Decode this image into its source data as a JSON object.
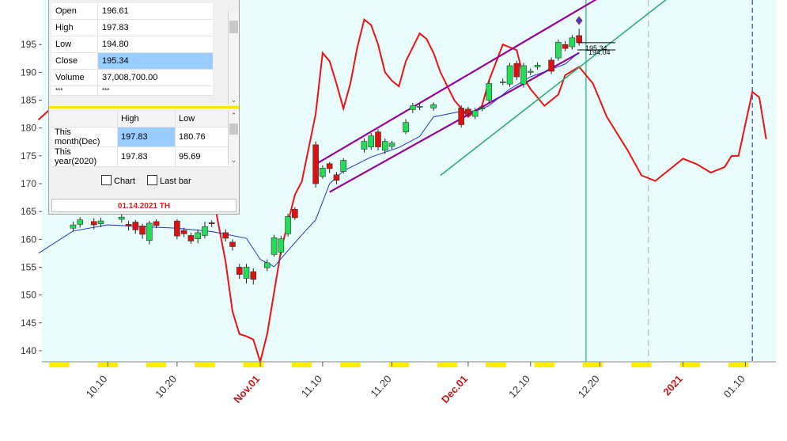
{
  "info_panel": {
    "rows": [
      {
        "label": "Open",
        "value": "196.61"
      },
      {
        "label": "High",
        "value": "197.83"
      },
      {
        "label": "Low",
        "value": "194.80"
      },
      {
        "label": "Close",
        "value": "195.34"
      },
      {
        "label": "Volume",
        "value": "37,008,700.00"
      },
      {
        "label": "***",
        "value": "***"
      }
    ],
    "range_header": {
      "high": "High",
      "low": "Low"
    },
    "range_rows": [
      {
        "label": "This month(Dec)",
        "high": "197.83",
        "low": "180.76"
      },
      {
        "label": "This year(2020)",
        "high": "197.83",
        "low": "95.69"
      }
    ],
    "chart_checkbox": "Chart",
    "lastbar_checkbox": "Last bar",
    "status_date": "01.14.2021 TH"
  },
  "price_tags": {
    "top": "195.34",
    "bottom": "194.04"
  },
  "colors": {
    "background": "#e8fcfc",
    "up": "#22dd55",
    "down": "#dd1111",
    "cycle": "#ee1111",
    "ma": "#2233cc",
    "channel": "#990099",
    "trend": "#33aa77"
  },
  "chart_data": {
    "type": "candlestick",
    "y_ticks": [
      140,
      145,
      150,
      155,
      160,
      165,
      170,
      175,
      180,
      185,
      190,
      195
    ],
    "ylim": [
      138,
      203
    ],
    "x_ticks": [
      {
        "label": "10.10",
        "day": 10,
        "red": false
      },
      {
        "label": "10.20",
        "day": 20,
        "red": false
      },
      {
        "label": "Nov.01",
        "day": 32,
        "red": true
      },
      {
        "label": "11.10",
        "day": 41,
        "red": false
      },
      {
        "label": "11.20",
        "day": 51,
        "red": false
      },
      {
        "label": "Dec.01",
        "day": 62,
        "red": true
      },
      {
        "label": "12.10",
        "day": 71,
        "red": false
      },
      {
        "label": "12.20",
        "day": 81,
        "red": false
      },
      {
        "label": "2021",
        "day": 93,
        "red": true
      },
      {
        "label": "01.10",
        "day": 102,
        "red": false
      }
    ],
    "candles": [
      {
        "day": 5,
        "o": 162.0,
        "c": 162.6,
        "h": 163.2,
        "l": 161.4
      },
      {
        "day": 6,
        "o": 162.7,
        "c": 163.5,
        "h": 164.0,
        "l": 162.1
      },
      {
        "day": 8,
        "o": 163.2,
        "c": 162.6,
        "h": 163.8,
        "l": 161.8
      },
      {
        "day": 9,
        "o": 162.8,
        "c": 163.3,
        "h": 163.9,
        "l": 162.2
      },
      {
        "day": 12,
        "o": 163.6,
        "c": 164.0,
        "h": 164.5,
        "l": 163.0
      },
      {
        "day": 13,
        "o": 162.7,
        "c": 162.4,
        "h": 163.3,
        "l": 161.6
      },
      {
        "day": 14,
        "o": 163.1,
        "c": 161.7,
        "h": 163.5,
        "l": 161.0
      },
      {
        "day": 15,
        "o": 162.4,
        "c": 160.9,
        "h": 162.8,
        "l": 160.1
      },
      {
        "day": 16,
        "o": 159.8,
        "c": 162.9,
        "h": 163.3,
        "l": 159.1
      },
      {
        "day": 17,
        "o": 163.2,
        "c": 162.5,
        "h": 163.6,
        "l": 162.0
      },
      {
        "day": 20,
        "o": 163.3,
        "c": 160.6,
        "h": 163.6,
        "l": 160.0
      },
      {
        "day": 21,
        "o": 161.6,
        "c": 161.0,
        "h": 162.1,
        "l": 160.4
      },
      {
        "day": 22,
        "o": 160.7,
        "c": 159.7,
        "h": 161.2,
        "l": 159.2
      },
      {
        "day": 23,
        "o": 160.1,
        "c": 161.2,
        "h": 161.8,
        "l": 159.3
      },
      {
        "day": 24,
        "o": 160.7,
        "c": 162.3,
        "h": 163.2,
        "l": 160.2
      },
      {
        "day": 25,
        "o": 163.0,
        "c": 162.8,
        "h": 163.4,
        "l": 162.2
      },
      {
        "day": 27,
        "o": 161.2,
        "c": 160.2,
        "h": 161.8,
        "l": 159.6
      },
      {
        "day": 28,
        "o": 159.5,
        "c": 158.7,
        "h": 160.0,
        "l": 158.0
      },
      {
        "day": 29,
        "o": 155.0,
        "c": 153.7,
        "h": 155.6,
        "l": 152.9
      },
      {
        "day": 30,
        "o": 153.0,
        "c": 155.0,
        "h": 155.6,
        "l": 152.1
      },
      {
        "day": 31,
        "o": 154.2,
        "c": 152.8,
        "h": 154.8,
        "l": 151.9
      },
      {
        "day": 33,
        "o": 154.9,
        "c": 155.8,
        "h": 156.4,
        "l": 154.3
      },
      {
        "day": 34,
        "o": 157.3,
        "c": 160.3,
        "h": 160.8,
        "l": 156.9
      },
      {
        "day": 35,
        "o": 157.7,
        "c": 160.1,
        "h": 160.6,
        "l": 157.2
      },
      {
        "day": 36,
        "o": 161.0,
        "c": 164.1,
        "h": 164.6,
        "l": 160.5
      },
      {
        "day": 37,
        "o": 165.4,
        "c": 163.9,
        "h": 165.8,
        "l": 163.5
      },
      {
        "day": 40,
        "o": 177.0,
        "c": 170.0,
        "h": 177.6,
        "l": 169.3
      },
      {
        "day": 41,
        "o": 171.3,
        "c": 172.8,
        "h": 173.3,
        "l": 170.9
      },
      {
        "day": 42,
        "o": 173.6,
        "c": 172.7,
        "h": 173.9,
        "l": 171.9
      },
      {
        "day": 43,
        "o": 171.6,
        "c": 170.6,
        "h": 172.1,
        "l": 169.9
      },
      {
        "day": 44,
        "o": 172.2,
        "c": 174.2,
        "h": 174.6,
        "l": 171.8
      },
      {
        "day": 47,
        "o": 176.2,
        "c": 177.6,
        "h": 178.1,
        "l": 175.6
      },
      {
        "day": 48,
        "o": 176.6,
        "c": 178.6,
        "h": 179.1,
        "l": 176.1
      },
      {
        "day": 49,
        "o": 179.3,
        "c": 176.6,
        "h": 179.8,
        "l": 176.0
      },
      {
        "day": 50,
        "o": 176.0,
        "c": 177.6,
        "h": 178.1,
        "l": 175.4
      },
      {
        "day": 51,
        "o": 176.7,
        "c": 177.3,
        "h": 177.7,
        "l": 176.2
      },
      {
        "day": 53,
        "o": 179.3,
        "c": 181.0,
        "h": 181.6,
        "l": 178.9
      },
      {
        "day": 54,
        "o": 183.3,
        "c": 184.0,
        "h": 184.5,
        "l": 182.7
      },
      {
        "day": 55,
        "o": 183.9,
        "c": 183.9,
        "h": 184.4,
        "l": 183.2
      },
      {
        "day": 57,
        "o": 183.6,
        "c": 184.2,
        "h": 184.6,
        "l": 183.1
      },
      {
        "day": 61,
        "o": 183.6,
        "c": 180.6,
        "h": 184.1,
        "l": 180.1
      },
      {
        "day": 62,
        "o": 183.4,
        "c": 182.6,
        "h": 183.8,
        "l": 182.1
      },
      {
        "day": 63,
        "o": 182.1,
        "c": 183.1,
        "h": 183.6,
        "l": 181.6
      },
      {
        "day": 64,
        "o": 183.5,
        "c": 183.6,
        "h": 184.0,
        "l": 183.0
      },
      {
        "day": 65,
        "o": 185.0,
        "c": 188.0,
        "h": 188.6,
        "l": 184.5
      },
      {
        "day": 67,
        "o": 188.3,
        "c": 188.3,
        "h": 188.9,
        "l": 187.7
      },
      {
        "day": 68,
        "o": 187.9,
        "c": 191.2,
        "h": 191.7,
        "l": 187.4
      },
      {
        "day": 69,
        "o": 191.6,
        "c": 189.2,
        "h": 192.1,
        "l": 188.6
      },
      {
        "day": 70,
        "o": 187.9,
        "c": 191.2,
        "h": 191.7,
        "l": 187.3
      },
      {
        "day": 71,
        "o": 190.0,
        "c": 190.2,
        "h": 190.7,
        "l": 189.5
      },
      {
        "day": 72,
        "o": 191.0,
        "c": 191.3,
        "h": 191.8,
        "l": 190.5
      },
      {
        "day": 74,
        "o": 192.2,
        "c": 190.2,
        "h": 192.7,
        "l": 189.7
      },
      {
        "day": 75,
        "o": 192.6,
        "c": 195.4,
        "h": 195.9,
        "l": 192.1
      },
      {
        "day": 76,
        "o": 195.0,
        "c": 194.3,
        "h": 195.6,
        "l": 193.8
      },
      {
        "day": 77,
        "o": 194.6,
        "c": 196.2,
        "h": 196.7,
        "l": 194.1
      },
      {
        "day": 78,
        "o": 196.61,
        "c": 195.34,
        "h": 197.83,
        "l": 194.8
      }
    ],
    "moving_average": [
      [
        0,
        157.5
      ],
      [
        5,
        161.5
      ],
      [
        10,
        162.6
      ],
      [
        15,
        162.3
      ],
      [
        20,
        162.0
      ],
      [
        25,
        161.4
      ],
      [
        30,
        160.2
      ],
      [
        32,
        156.4
      ],
      [
        34,
        155.1
      ],
      [
        36,
        158.0
      ],
      [
        38,
        160.8
      ],
      [
        40,
        163.5
      ],
      [
        42,
        170.0
      ],
      [
        44,
        172.3
      ],
      [
        48,
        174.8
      ],
      [
        52,
        176.5
      ],
      [
        55,
        178.5
      ],
      [
        57,
        182.0
      ],
      [
        61,
        183.0
      ],
      [
        63,
        183.0
      ],
      [
        65,
        184.0
      ],
      [
        68,
        187.0
      ],
      [
        71,
        189.2
      ],
      [
        73,
        190.1
      ],
      [
        76,
        191.5
      ],
      [
        78,
        193.6
      ]
    ],
    "cycle_line": [
      [
        0,
        181.5
      ],
      [
        4,
        186.0
      ],
      [
        8,
        190.0
      ],
      [
        12,
        190.0
      ],
      [
        16,
        188.0
      ],
      [
        19,
        184.0
      ],
      [
        22,
        178.0
      ],
      [
        25,
        169.0
      ],
      [
        27,
        156.0
      ],
      [
        28,
        147.0
      ],
      [
        29,
        143.0
      ],
      [
        30,
        142.6
      ],
      [
        31,
        142.0
      ],
      [
        32,
        138.0
      ],
      [
        33,
        143.0
      ],
      [
        35,
        158.0
      ],
      [
        37,
        168.0
      ],
      [
        38,
        170.4
      ],
      [
        40,
        182.5
      ],
      [
        41,
        193.5
      ],
      [
        42,
        192.0
      ],
      [
        43,
        188.0
      ],
      [
        44,
        183.5
      ],
      [
        45,
        188.0
      ],
      [
        46,
        194.5
      ],
      [
        47,
        199.5
      ],
      [
        48,
        198.5
      ],
      [
        49,
        195.0
      ],
      [
        50,
        190.0
      ],
      [
        51,
        188.5
      ],
      [
        52,
        187.5
      ],
      [
        53,
        192.0
      ],
      [
        55,
        197.0
      ],
      [
        56,
        196.0
      ],
      [
        57,
        193.5
      ],
      [
        58,
        190.0
      ],
      [
        60,
        185.0
      ],
      [
        62,
        182.0
      ],
      [
        64,
        184.0
      ],
      [
        65,
        188.5
      ],
      [
        67,
        195.0
      ],
      [
        69,
        194.0
      ],
      [
        70,
        189.0
      ],
      [
        71,
        187.0
      ],
      [
        73,
        184.0
      ],
      [
        75,
        186.0
      ],
      [
        76,
        189.5
      ],
      [
        78,
        191.0
      ],
      [
        80,
        188.0
      ],
      [
        82,
        182.0
      ],
      [
        85,
        176.0
      ],
      [
        87,
        171.5
      ],
      [
        89,
        170.5
      ],
      [
        91,
        172.5
      ],
      [
        93,
        174.5
      ],
      [
        95,
        173.5
      ],
      [
        97,
        172.0
      ],
      [
        99,
        173.0
      ],
      [
        100,
        175.0
      ],
      [
        101,
        175.0
      ],
      [
        103,
        186.5
      ],
      [
        104,
        185.5
      ],
      [
        105,
        178.0
      ]
    ],
    "channel_lines": [
      [
        40,
        173.5,
        81,
        203.5
      ],
      [
        42,
        168.5,
        78,
        193.5
      ]
    ],
    "trend_line": [
      [
        58,
        171.5,
        91,
        203.5
      ]
    ],
    "vertical_lines": [
      {
        "day": 79,
        "style": "solid"
      },
      {
        "day": 88,
        "style": "dashed"
      },
      {
        "day": 103,
        "style": "dashed-blue"
      }
    ],
    "xlim": [
      0.5,
      106.4
    ]
  }
}
